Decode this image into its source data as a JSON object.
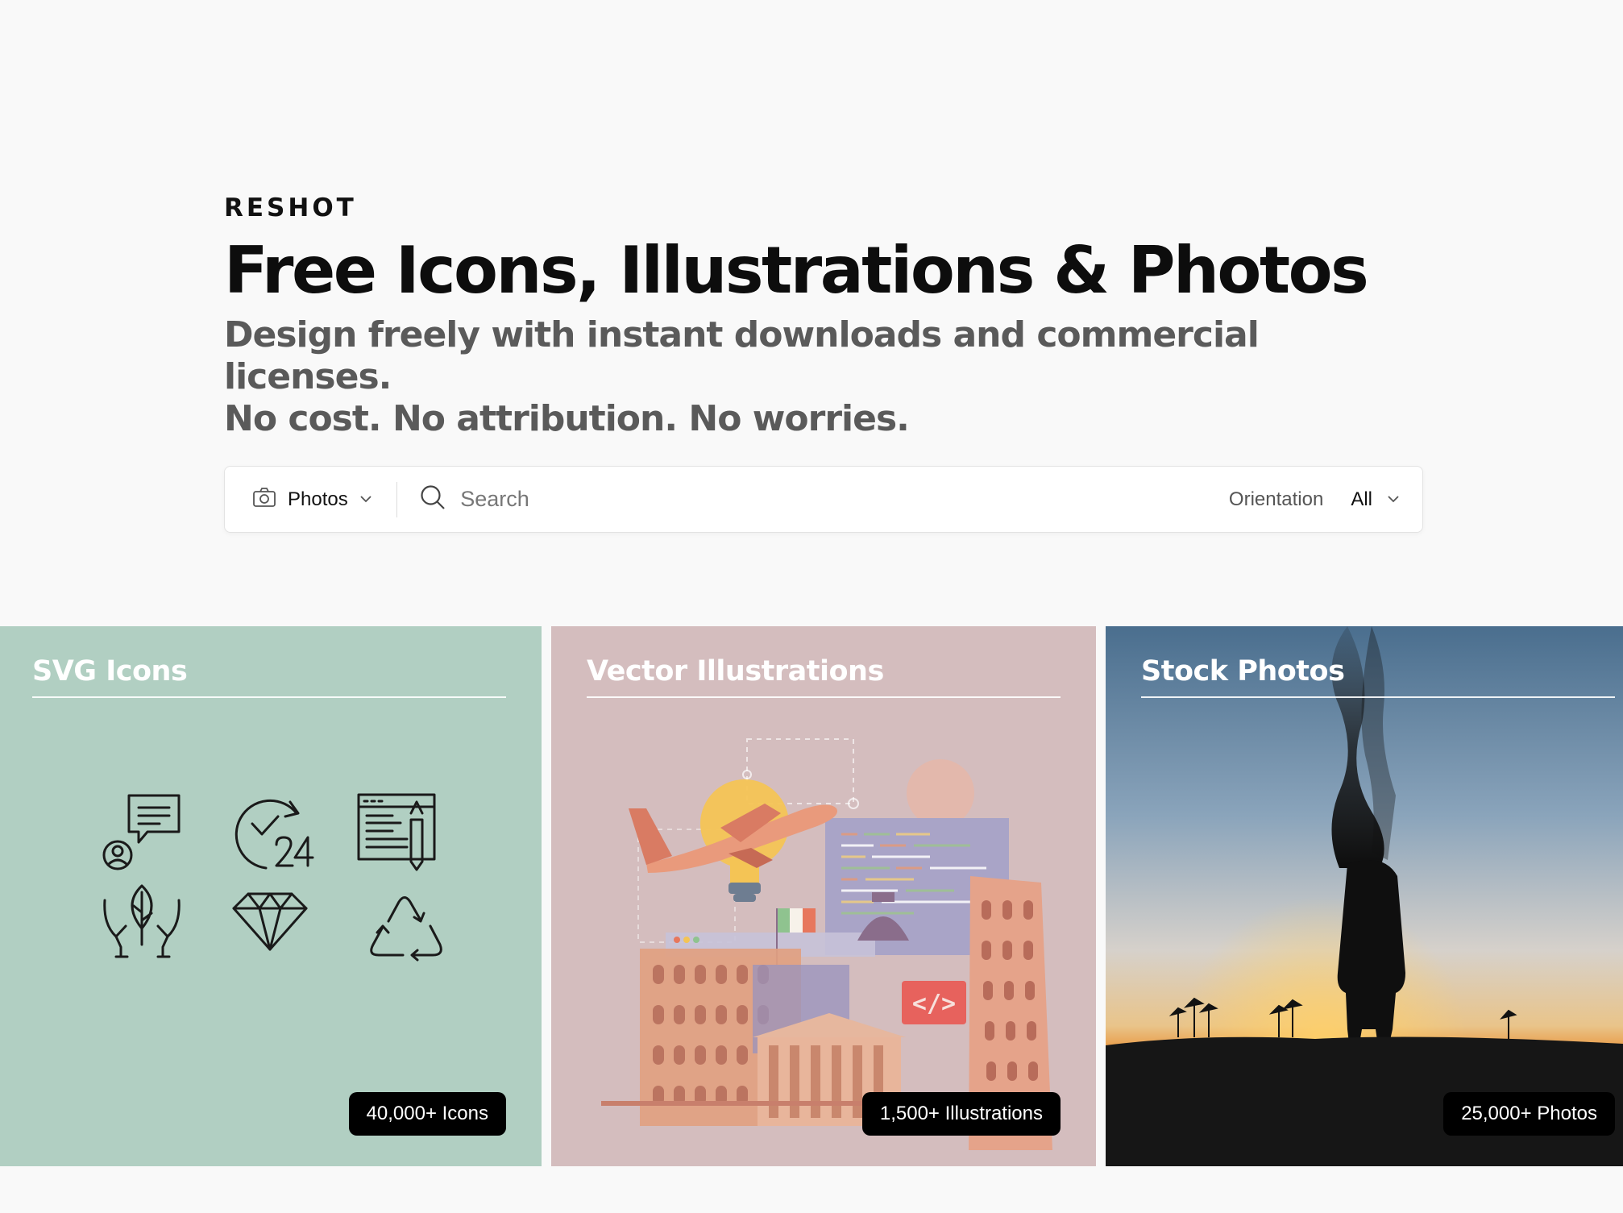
{
  "brand": {
    "logo_text": "RESHOT"
  },
  "hero": {
    "title": "Free Icons, Illustrations & Photos",
    "subtitle_line1": "Design freely with instant downloads and commercial licenses.",
    "subtitle_line2": "No cost. No attribution. No worries."
  },
  "search": {
    "type_label": "Photos",
    "placeholder": "Search",
    "orientation_label": "Orientation",
    "orientation_value": "All"
  },
  "cards": [
    {
      "title": "SVG Icons",
      "badge": "40,000+ Icons",
      "bg": "#b1cfc2"
    },
    {
      "title": "Vector Illustrations",
      "badge": "1,500+ Illustrations",
      "bg": "#d4bdbe"
    },
    {
      "title": "Stock Photos",
      "badge": "25,000+ Photos"
    }
  ],
  "icons": [
    "camera-icon",
    "chevron-down-icon",
    "search-icon",
    "chat-support-icon",
    "24-hour-icon",
    "web-editor-icon",
    "hands-plant-icon",
    "diamond-icon",
    "recycle-icon"
  ]
}
